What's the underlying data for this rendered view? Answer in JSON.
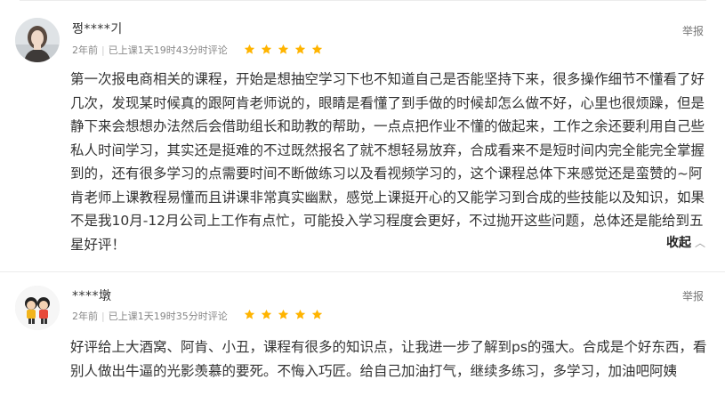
{
  "accent_star_color": "#ffb400",
  "reviews": [
    {
      "username": "쩡****기",
      "time_ago": "2年前",
      "progress": "已上课1天19时43分时评论",
      "rating": 5,
      "report_label": "举报",
      "content": "第一次报电商相关的课程，开始是想抽空学习下也不知道自己是否能坚持下来，很多操作细节不懂看了好几次，发现某时候真的跟阿肯老师说的，眼睛是看懂了到手做的时候却怎么做不好，心里也很烦躁，但是静下来会想想办法然后会借助组长和助教的帮助，一点点把作业不懂的做起来，工作之余还要利用自己些私人时间学习，其实还是挺难的不过既然报名了就不想轻易放弃，合成看来不是短时间内完全能完全掌握到的，还有很多学习的点需要时间不断做练习以及看视频学习的，这个课程总体下来感觉还是蛮赞的~阿肯老师上课教程易懂而且讲课非常真实幽默，感觉上课挺开心的又能学习到合成的些技能以及知识，如果不是我10月-12月公司上工作有点忙，可能投入学习程度会更好，不过抛开这些问题，总体还是能给到五星好评！",
      "collapse_label": "收起",
      "avatar_icon": "woman-portrait-avatar"
    },
    {
      "username": "****墩",
      "time_ago": "2年前",
      "progress": "已上课1天19时35分时评论",
      "rating": 5,
      "report_label": "举报",
      "content": "好评给上大酒窝、阿肯、小丑，课程有很多的知识点，让我进一步了解到ps的强大。合成是个好东西，看别人做出牛逼的光影羡慕的要死。不悔入巧匠。给自己加油打气，继续多练习，多学习，加油吧阿姨",
      "avatar_icon": "cartoon-avatar"
    }
  ]
}
